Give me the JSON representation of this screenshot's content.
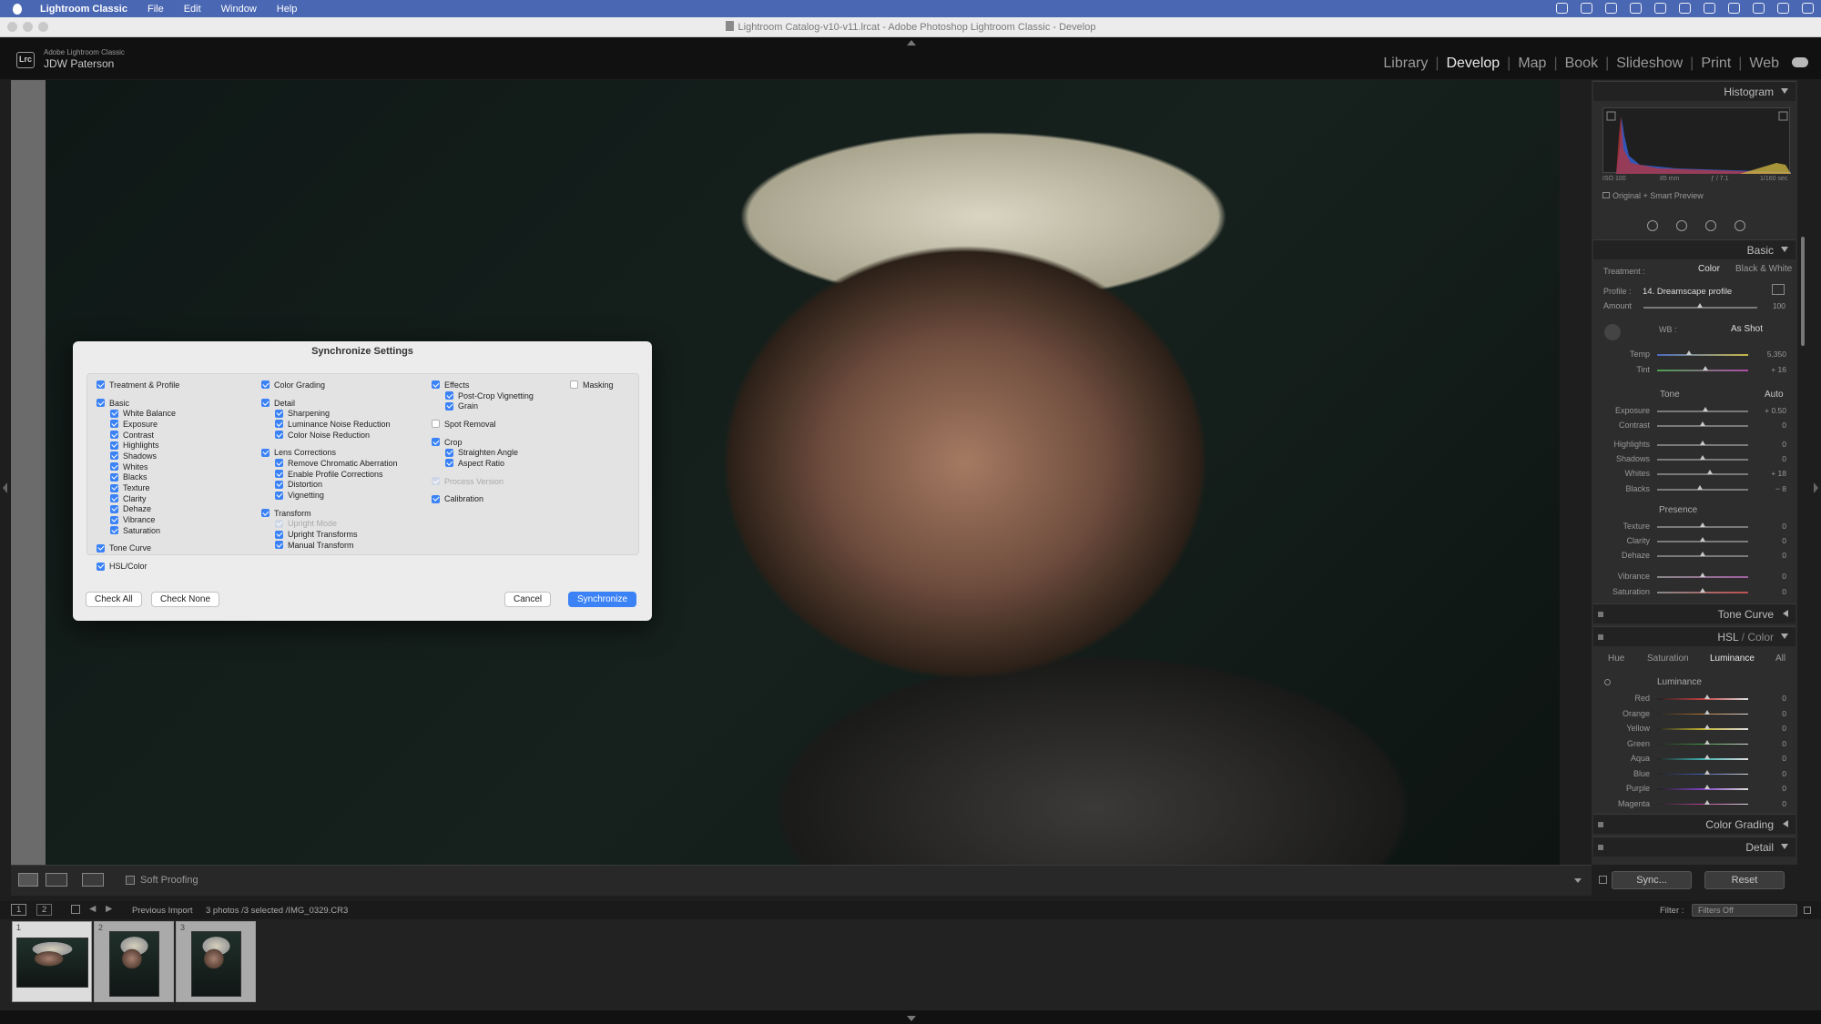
{
  "menubar": {
    "app": "Lightroom Classic",
    "items": [
      "File",
      "Edit",
      "Window",
      "Help"
    ]
  },
  "window": {
    "title": "Lightroom Catalog-v10-v11.lrcat - Adobe Photoshop Lightroom Classic - Develop"
  },
  "identity": {
    "badge": "Lrc",
    "product": "Adobe Lightroom Classic",
    "user": "JDW Paterson"
  },
  "modules": {
    "items": [
      "Library",
      "Develop",
      "Map",
      "Book",
      "Slideshow",
      "Print",
      "Web"
    ],
    "active": "Develop"
  },
  "dialog": {
    "title": "Synchronize Settings",
    "col1": {
      "treatment": "Treatment & Profile",
      "basic": "Basic",
      "basic_items": [
        "White Balance",
        "Exposure",
        "Contrast",
        "Highlights",
        "Shadows",
        "Whites",
        "Blacks",
        "Texture",
        "Clarity",
        "Dehaze",
        "Vibrance",
        "Saturation"
      ],
      "tone_curve": "Tone Curve",
      "hsl": "HSL/Color"
    },
    "col2": {
      "color_grading": "Color Grading",
      "detail": "Detail",
      "detail_items": [
        "Sharpening",
        "Luminance Noise Reduction",
        "Color Noise Reduction"
      ],
      "lens": "Lens Corrections",
      "lens_items": [
        "Remove Chromatic Aberration",
        "Enable Profile Corrections",
        "Distortion",
        "Vignetting"
      ],
      "transform": "Transform",
      "transform_items": [
        "Upright Mode",
        "Upright Transforms",
        "Manual Transform"
      ]
    },
    "col3": {
      "effects": "Effects",
      "effects_items": [
        "Post-Crop Vignetting",
        "Grain"
      ],
      "spot": "Spot Removal",
      "crop": "Crop",
      "crop_items": [
        "Straighten Angle",
        "Aspect Ratio"
      ],
      "process": "Process Version",
      "calibration": "Calibration"
    },
    "col4": {
      "masking": "Masking"
    },
    "buttons": {
      "check_all": "Check All",
      "check_none": "Check None",
      "cancel": "Cancel",
      "sync": "Synchronize"
    }
  },
  "histogram": {
    "title": "Histogram",
    "iso": "ISO 100",
    "focal": "85 mm",
    "aperture": "ƒ / 7.1",
    "shutter": "1/160 sec",
    "preview": "Original + Smart Preview"
  },
  "basic": {
    "title": "Basic",
    "treatment_label": "Treatment :",
    "treatment_color": "Color",
    "treatment_bw": "Black & White",
    "profile_label": "Profile :",
    "profile_value": "14. Dreamscape profile",
    "amount_label": "Amount",
    "amount_value": "100",
    "wb_label": "WB :",
    "wb_value": "As Shot",
    "temp_label": "Temp",
    "temp_value": "5,350",
    "tint_label": "Tint",
    "tint_value": "+ 16",
    "tone_label": "Tone",
    "auto": "Auto",
    "exposure_label": "Exposure",
    "exposure_value": "+ 0.50",
    "contrast_label": "Contrast",
    "contrast_value": "0",
    "highlights_label": "Highlights",
    "highlights_value": "0",
    "shadows_label": "Shadows",
    "shadows_value": "0",
    "whites_label": "Whites",
    "whites_value": "+ 18",
    "blacks_label": "Blacks",
    "blacks_value": "− 8",
    "presence_label": "Presence",
    "texture_label": "Texture",
    "texture_value": "0",
    "clarity_label": "Clarity",
    "clarity_value": "0",
    "dehaze_label": "Dehaze",
    "dehaze_value": "0",
    "vibrance_label": "Vibrance",
    "vibrance_value": "0",
    "saturation_label": "Saturation",
    "saturation_value": "0"
  },
  "panels": {
    "tone_curve": "Tone Curve",
    "hsl_a": "HSL",
    "hsl_b": "Color",
    "color_grading": "Color Grading",
    "detail": "Detail"
  },
  "hsl": {
    "tabs": [
      "Hue",
      "Saturation",
      "Luminance",
      "All"
    ],
    "active_tab": "Luminance",
    "section": "Luminance",
    "labels": [
      "Red",
      "Orange",
      "Yellow",
      "Green",
      "Aqua",
      "Blue",
      "Purple",
      "Magenta"
    ],
    "values": [
      "0",
      "0",
      "0",
      "0",
      "0",
      "0",
      "0",
      "0"
    ]
  },
  "toolbar": {
    "soft_proofing": "Soft Proofing",
    "sync": "Sync...",
    "reset": "Reset"
  },
  "filmbar": {
    "pages": [
      "1",
      "2"
    ],
    "source": "Previous Import",
    "selection": "3 photos /3 selected /IMG_0329.CR3",
    "filter_label": "Filter :",
    "filter_value": "Filters Off"
  },
  "filmstrip": {
    "numbers": [
      "1",
      "2",
      "3"
    ]
  },
  "colors": {
    "accent": "#3b82f6",
    "menubar": "#4a67b3"
  }
}
